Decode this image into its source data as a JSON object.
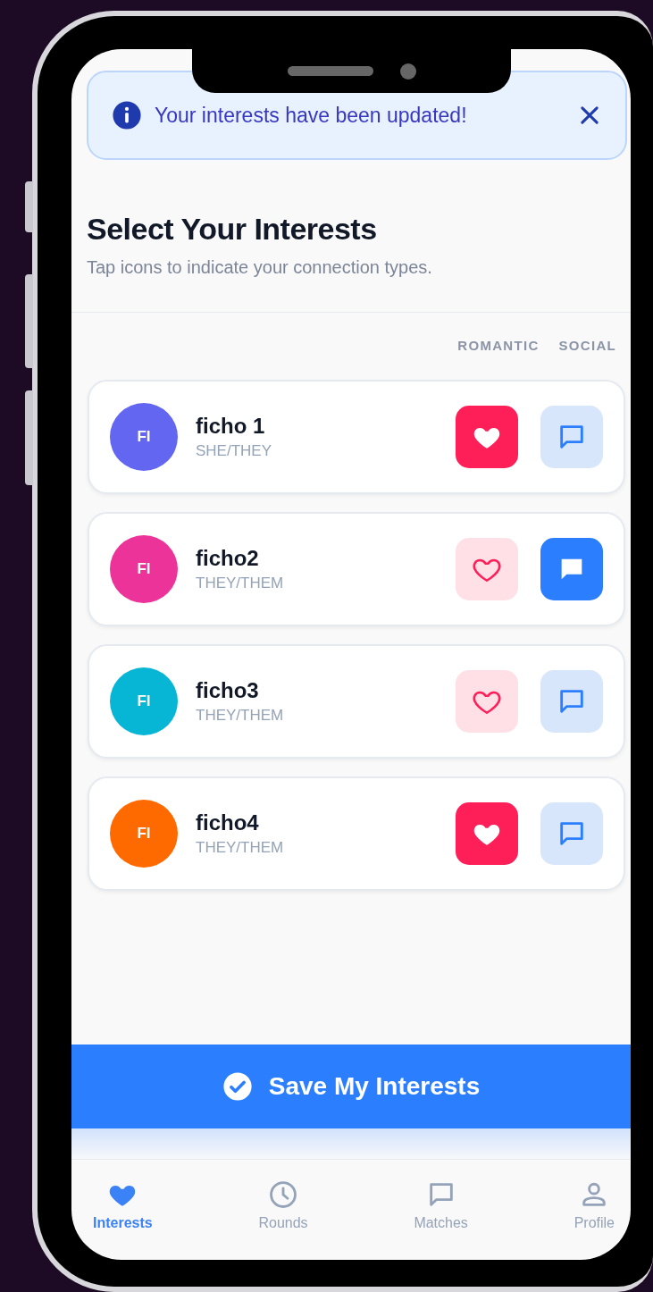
{
  "notification": {
    "text": "Your interests have been updated!"
  },
  "header": {
    "title": "Select Your Interests",
    "subtitle": "Tap icons to indicate your connection types."
  },
  "columns": [
    "ROMANTIC",
    "SOCIAL"
  ],
  "people": [
    {
      "name": "ficho 1",
      "pronouns": "SHE/THEY",
      "initials": "FI",
      "color": "#6366f1",
      "romantic": {
        "selected": true
      },
      "social": {
        "selected": false
      }
    },
    {
      "name": "ficho2",
      "pronouns": "THEY/THEM",
      "initials": "FI",
      "color": "#ec3399",
      "romantic": {
        "selected": false
      },
      "social": {
        "selected": true
      }
    },
    {
      "name": "ficho3",
      "pronouns": "THEY/THEM",
      "initials": "FI",
      "color": "#06b6d4",
      "romantic": {
        "selected": false
      },
      "social": {
        "selected": false
      }
    },
    {
      "name": "ficho4",
      "pronouns": "THEY/THEM",
      "initials": "FI",
      "color": "#ff6a00",
      "romantic": {
        "selected": true
      },
      "social": {
        "selected": false
      }
    }
  ],
  "save_button": {
    "label": "Save My Interests"
  },
  "nav": [
    {
      "kind": "heart",
      "label": "Interests",
      "selected": true
    },
    {
      "kind": "clock",
      "label": "Rounds",
      "selected": false
    },
    {
      "kind": "chat",
      "label": "Matches",
      "selected": false
    },
    {
      "kind": "person",
      "label": "Profile",
      "selected": false
    }
  ]
}
